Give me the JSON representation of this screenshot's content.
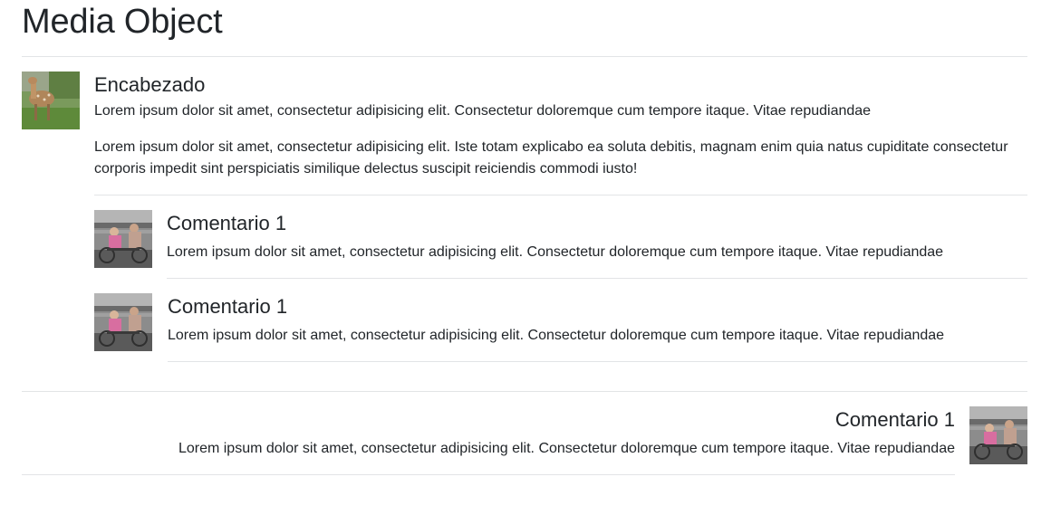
{
  "page": {
    "title": "Media Object"
  },
  "main_media": {
    "thumbnail_icon": "deer-photo",
    "heading": "Encabezado",
    "paragraph1": "Lorem ipsum dolor sit amet, consectetur adipisicing elit. Consectetur doloremque cum tempore itaque. Vitae repudiandae",
    "paragraph2": "Lorem ipsum dolor sit amet, consectetur adipisicing elit. Iste totam explicabo ea soluta debitis, magnam enim quia natus cupiditate consectetur corporis impedit sint perspiciatis similique delectus suscipit reiciendis commodi iusto!"
  },
  "comments": [
    {
      "thumbnail_icon": "kids-photo",
      "heading": "Comentario 1",
      "text": "Lorem ipsum dolor sit amet, consectetur adipisicing elit. Consectetur doloremque cum tempore itaque. Vitae repudiandae"
    },
    {
      "thumbnail_icon": "kids-photo",
      "heading": "Comentario 1",
      "text": "Lorem ipsum dolor sit amet, consectetur adipisicing elit. Consectetur doloremque cum tempore itaque. Vitae repudiandae"
    }
  ],
  "right_media": {
    "thumbnail_icon": "kids-photo",
    "heading": "Comentario 1",
    "text": "Lorem ipsum dolor sit amet, consectetur adipisicing elit. Consectetur doloremque cum tempore itaque. Vitae repudiandae"
  }
}
